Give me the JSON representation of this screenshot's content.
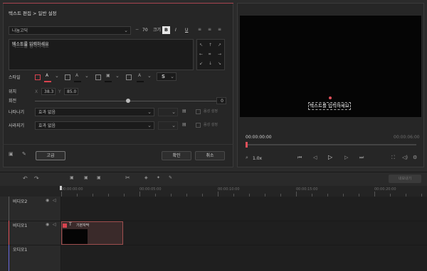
{
  "breadcrumb": "텍스트 편집 > 일반 설정",
  "font": {
    "name": "나눔고딕",
    "size": "70",
    "size_label": "크기",
    "bold": "B",
    "italic": "I",
    "underline": "U"
  },
  "text_area": {
    "placeholder": "텍스트를 입력하세요"
  },
  "style": {
    "label": "스타일",
    "shadow_letter": "S"
  },
  "position": {
    "label": "위치",
    "x_label": "X",
    "x_value": "38.3",
    "y_label": "Y",
    "y_value": "85.0"
  },
  "rotation": {
    "label": "회전",
    "value": "0",
    "level": 0.5
  },
  "appear": {
    "label": "나타나기",
    "value": "효과 없음",
    "extra": "음성 설정"
  },
  "disappear": {
    "label": "사라지기",
    "value": "효과 없음",
    "extra": "음성 설정"
  },
  "buttons": {
    "template": "고급",
    "ok": "확인",
    "cancel": "취소"
  },
  "preview": {
    "caption": "텍스트를 입력하세요",
    "time_current": "00:00:00:00",
    "time_total": "00:00:06:00",
    "zoom": "1.0x"
  },
  "timeline": {
    "export_label": "내보내기",
    "ruler": [
      "00:00:00:00",
      "00:00:05:00",
      "00:00:10:00",
      "00:00:15:00",
      "00:00:20:00"
    ],
    "tracks": [
      {
        "name": "비디오2"
      },
      {
        "name": "비디오1"
      },
      {
        "name": "오디오1"
      }
    ],
    "clip_label": "기본자막"
  },
  "colors": {
    "accent": "#d9434f",
    "playhead": "#e0505a",
    "audio_line": "#6a6ae0"
  }
}
